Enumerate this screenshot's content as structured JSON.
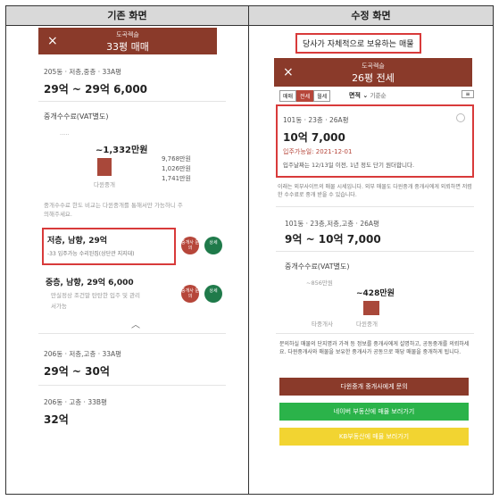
{
  "left": {
    "header": "기존 화면",
    "bar_small": "도곡렉슬",
    "bar_big": "33평 매매",
    "close_icon": "×",
    "listing1": {
      "line": "205동 · 저층,중층 · 33A평",
      "price": "29억 ~ 29억 6,000"
    },
    "fee_title": "중개수수료(VAT별도)",
    "fee_amount": "~1,332만원",
    "fee_bar_label": "다윈중개",
    "fee_lines": [
      "9,768만원",
      "1,026만원",
      "1,741만원"
    ],
    "note_line1": "중개수수료 한도 비교는 다윈중개를 통해서만 가능하니 주",
    "note_line2": "의해주세요.",
    "highlight_title": "저층, 남향, 29억",
    "highlight_sub": "-33 입주가능 수리된집(상단관 지지대)",
    "inquire_label": "중개사 문의",
    "detail_label": "상세",
    "listing2": {
      "title": "중층, 남향, 29억 6,000",
      "sub1": "만실정상 조건말 탄탄한 입주 및 관리",
      "sub2": "서가능"
    },
    "chevron_up": "︿",
    "listing3": {
      "line": "206동 · 저층,고층 · 33A평",
      "price": "29억 ~ 30억"
    },
    "listing4": {
      "line": "206동 · 고층 · 33B평",
      "price": "32억"
    }
  },
  "right": {
    "header": "수정 화면",
    "tag": "당사가 자체적으로 보유하는 매물",
    "bar_small": "도곡렉슬",
    "bar_big": "26평 전세",
    "close_icon": "×",
    "tabs": [
      "매매",
      "전세",
      "월세"
    ],
    "sort_label": "면적",
    "sort_extra": "기준순",
    "listing_main": {
      "line": "101동 · 23층 · 26A평",
      "price": "10억 7,000",
      "date": "입주가능일: 2021-12-01",
      "desc": "입주날짜는 12/13일 이전, 1년 정도 단기 원더합니다."
    },
    "notice": "이래는 외부사이트의 매물 시세입니다. 외부 매물도 다윈중개 중개사에게 외뢰하면 저렴한 수수료로 중개 받을 수 있습니다.",
    "listing2": {
      "line": "101동 · 23층,저층,고층 · 26A평",
      "price": "9억 ~ 10억 7,000"
    },
    "fee_title": "중개수수료(VAT별도)",
    "fee_top": "~856만원",
    "fee_amount": "~428만원",
    "fee_label_left": "타중개사",
    "fee_label_right": "다윈중개",
    "info": "문의하실 매물의 단지명과 가격 등 정보를 중개사에게 설명하고, 공동중개를 의뢰하세요. 다윈중개사와 매물을 보유한 중개사가 공동으로 해당 매물을 중개하게 됩니다.",
    "btn_brown": "다윈중개 중개사에게 문의",
    "btn_green": "네이버 부동산에 매물 보러가기",
    "btn_yellow": "KB부동산에 매물 보러가기"
  }
}
